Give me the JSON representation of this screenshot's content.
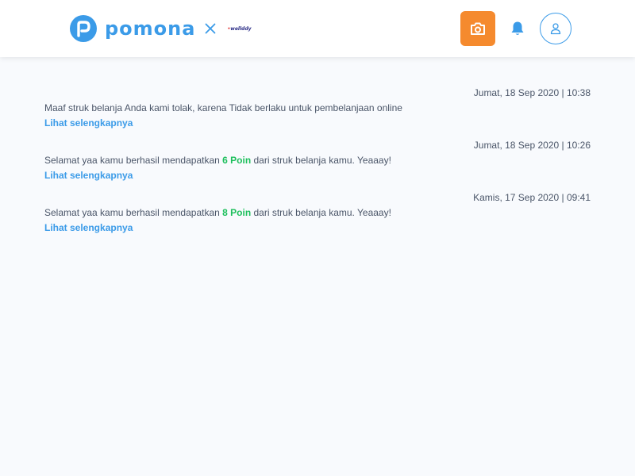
{
  "header": {
    "brand_name": "pomona",
    "partner_logo_text": "wellddy",
    "icons": {
      "logo": "pomona-logo-icon",
      "times": "times-icon",
      "camera": "camera-icon",
      "bell": "bell-icon",
      "user": "user-icon"
    },
    "colors": {
      "brand": "#3b9be8",
      "camera_button": "#f58a2e",
      "points": "#1dbf5c"
    }
  },
  "notifications": [
    {
      "time": "Jumat, 18 Sep 2020 | 10:38",
      "message": "Maaf struk belanja Anda kami tolak, karena Tidak berlaku untuk pembelanjaan online",
      "link": "Lihat selengkapnya"
    },
    {
      "time": "Jumat, 18 Sep 2020 | 10:26",
      "message_before": "Selamat yaa kamu berhasil mendapatkan ",
      "points": "6 Poin",
      "message_after": " dari struk belanja kamu. Yeaaay!",
      "link": "Lihat selengkapnya"
    },
    {
      "time": "Kamis, 17 Sep 2020 | 09:41",
      "message_before": "Selamat yaa kamu berhasil mendapatkan ",
      "points": "8 Poin",
      "message_after": " dari struk belanja kamu. Yeaaay!",
      "link": "Lihat selengkapnya"
    }
  ]
}
